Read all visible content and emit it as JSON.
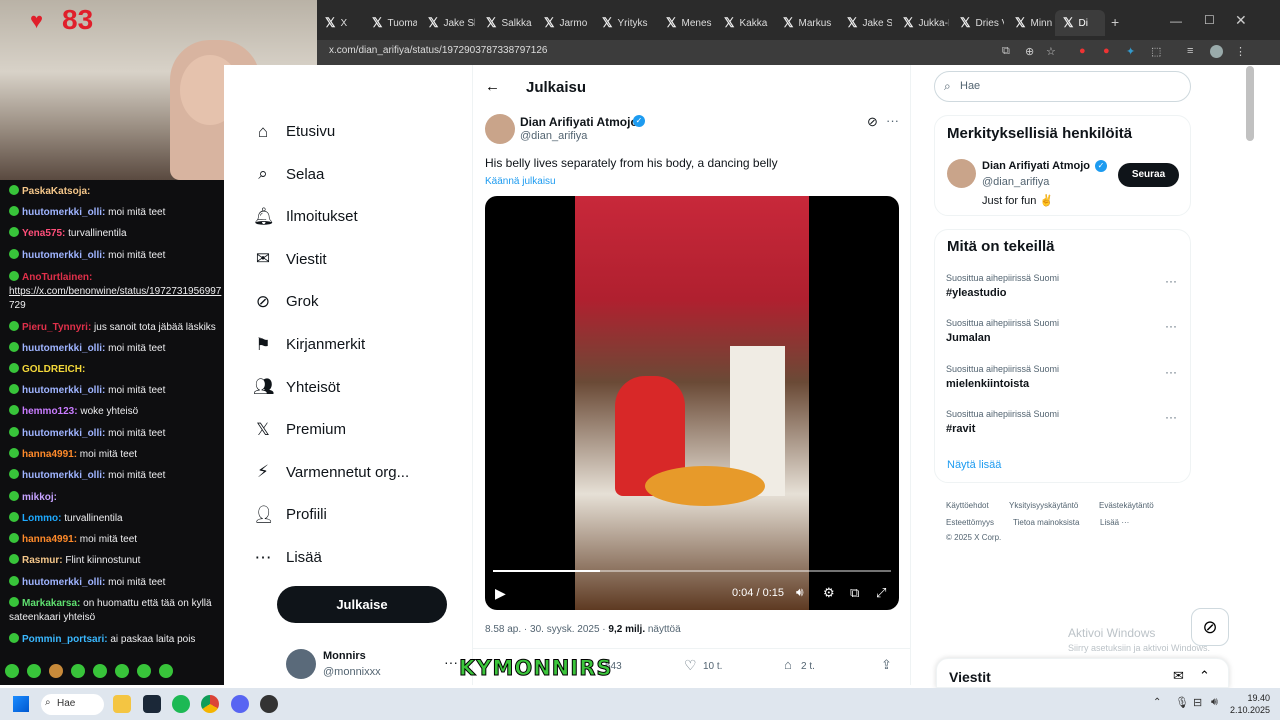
{
  "stream": {
    "heart_count": "83",
    "overlay_logo": "KYMONNIRS"
  },
  "browser": {
    "tabs": [
      "X",
      "Tuoma",
      "Jake Sh",
      "Salkka",
      "Jarmo",
      "Yrityks",
      "Menes",
      "Kakka",
      "Markus",
      "Jake Sh",
      "Jukka-F",
      "Dries V",
      "Minna",
      "Di"
    ],
    "url": "x.com/dian_arifiya/status/1972903787338797126"
  },
  "chat": {
    "messages": [
      {
        "user": "PaskaKatsoja:",
        "text": "",
        "color": "#f5c78a"
      },
      {
        "user": "huutomerkki_olli:",
        "text": " moi mitä teet",
        "color": "#9fb4ff"
      },
      {
        "user": "Yena575:",
        "text": " turvallinentila",
        "color": "#ff4f7a"
      },
      {
        "user": "huutomerkki_olli:",
        "text": " moi mitä teet",
        "color": "#9fb4ff"
      },
      {
        "user": "AnoTurtlainen:",
        "text": "",
        "color": "#e0304a"
      },
      {
        "user": "",
        "text": "https://x.com/benonwine/status/1972731956997",
        "color": "#efeff1"
      },
      {
        "user": "",
        "text": "729",
        "color": "#efeff1"
      },
      {
        "user": "Pieru_Tynnyri:",
        "text": " jus sanoit tota jäbää läskiks",
        "color": "#e0304a"
      },
      {
        "user": "huutomerkki_olli:",
        "text": " moi mitä teet",
        "color": "#9fb4ff"
      },
      {
        "user": "GOLDREICH:",
        "text": "",
        "color": "#f4d83a"
      },
      {
        "user": "huutomerkki_olli:",
        "text": " moi mitä teet",
        "color": "#9fb4ff"
      },
      {
        "user": "hemmo123:",
        "text": " woke yhteisö",
        "color": "#c97cff"
      },
      {
        "user": "huutomerkki_olli:",
        "text": " moi mitä teet",
        "color": "#9fb4ff"
      },
      {
        "user": "hanna4991:",
        "text": " moi mitä teet",
        "color": "#ff8a2a"
      },
      {
        "user": "huutomerkki_olli:",
        "text": " moi mitä teet",
        "color": "#9fb4ff"
      },
      {
        "user": "mikkoj:",
        "text": "",
        "color": "#c6a3ff"
      },
      {
        "user": "Lommo:",
        "text": " turvallinentila",
        "color": "#1eaaff"
      },
      {
        "user": "hanna4991:",
        "text": " moi mitä teet",
        "color": "#ff8a2a"
      },
      {
        "user": "Rasmur:",
        "text": " Flint kiinnostunut",
        "color": "#f5c78a"
      },
      {
        "user": "huutomerkki_olli:",
        "text": " moi mitä teet",
        "color": "#9fb4ff"
      },
      {
        "user": "Markakarsa:",
        "text": " on huomattu että tää on kyllä",
        "color": "#5fe070"
      },
      {
        "user": "",
        "text": "sateenkaari yhteisö",
        "color": "#efeff1"
      },
      {
        "user": "Pommin_portsari:",
        "text": " ai paskaa laita pois",
        "color": "#3ab8ff"
      }
    ]
  },
  "nav": {
    "items": [
      {
        "label": "Etusivu",
        "icon": "home-icon"
      },
      {
        "label": "Selaa",
        "icon": "search-icon"
      },
      {
        "label": "Ilmoitukset",
        "icon": "bell-icon"
      },
      {
        "label": "Viestit",
        "icon": "mail-icon"
      },
      {
        "label": "Grok",
        "icon": "grok-icon"
      },
      {
        "label": "Kirjanmerkit",
        "icon": "bookmark-icon"
      },
      {
        "label": "Yhteisöt",
        "icon": "people-icon"
      },
      {
        "label": "Premium",
        "icon": "x-logo-icon"
      },
      {
        "label": "Varmennetut org...",
        "icon": "lightning-icon"
      },
      {
        "label": "Profiili",
        "icon": "person-icon"
      },
      {
        "label": "Lisää",
        "icon": "more-icon"
      }
    ],
    "post_button": "Julkaise",
    "account_name": "Monnirs",
    "account_handle": "@monnixxx"
  },
  "post": {
    "header_title": "Julkaisu",
    "author_name": "Dian Arifiyati Atmojo",
    "author_handle": "@dian_arifiya",
    "text": "His belly lives separately from his body, a dancing belly",
    "translate": "Käännä julkaisu",
    "video_time": "0:04 / 0:15",
    "video_progress": 0.27,
    "timestamp": "8.58 ap. · 30. syysk. 2025 · ",
    "views": "9,2 milj.",
    "views_label": " näyttöä",
    "replies": "543",
    "likes": "10 t.",
    "bookmarks": "2 t."
  },
  "sidebar": {
    "search_placeholder": "Hae",
    "who_title": "Merkityksellisiä henkilöitä",
    "who_name": "Dian Arifiyati Atmojo",
    "who_handle": "@dian_arifiya",
    "who_bio": "Just for fun ✌",
    "follow_label": "Seuraa",
    "trends_title": "Mitä on tekeillä",
    "trends": [
      {
        "context": "Suosittua aihepiirissä Suomi",
        "title": "#yleastudio"
      },
      {
        "context": "Suosittua aihepiirissä Suomi",
        "title": "Jumalan"
      },
      {
        "context": "Suosittua aihepiirissä Suomi",
        "title": "mielenkiintoista"
      },
      {
        "context": "Suosittua aihepiirissä Suomi",
        "title": "#ravit"
      }
    ],
    "show_more": "Näytä lisää",
    "footer": [
      "Käyttöehdot",
      "Yksityisyyskäytäntö",
      "Evästekäytäntö",
      "Esteettömyys",
      "Tietoa mainoksista",
      "Lisää ···",
      "© 2025 X Corp."
    ],
    "activate_title": "Aktivoi Windows",
    "activate_sub": "Siirry asetuksiin ja aktivoi Windows.",
    "messages_label": "Viestit"
  },
  "taskbar": {
    "search_label": "Hae",
    "time": "19.40",
    "date": "2.10.2025"
  }
}
